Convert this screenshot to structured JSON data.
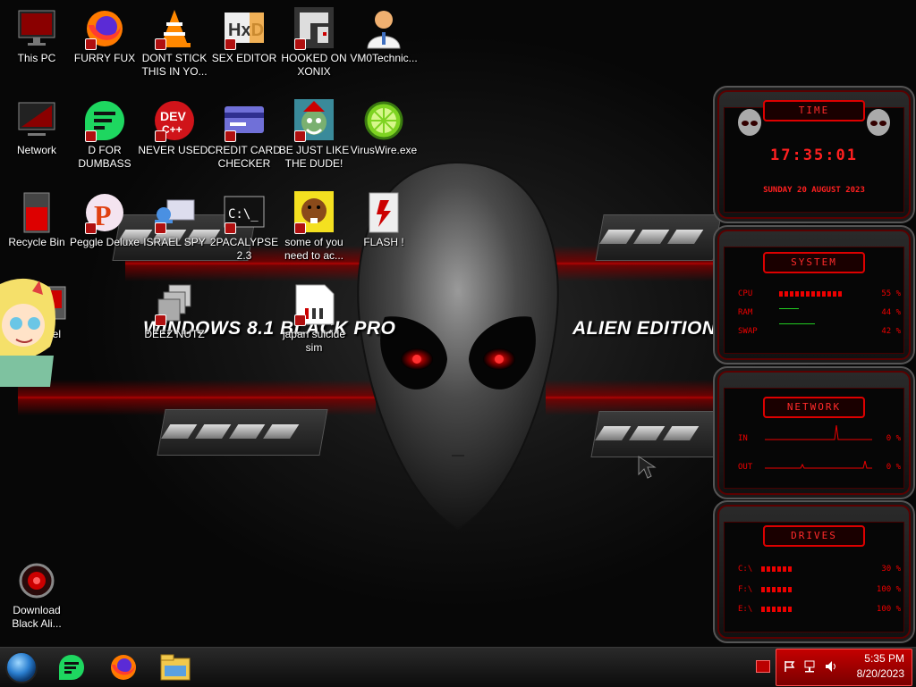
{
  "wallpaper": {
    "left_text": "WINDOWS 8.1 BLACK PRO",
    "right_text": "ALIEN EDITION 20"
  },
  "desktop_icons": [
    {
      "label": "This PC",
      "icon": "monitor-icon"
    },
    {
      "label": "FURRY FUX",
      "icon": "firefox-icon"
    },
    {
      "label": "DONT STICK THIS IN YO...",
      "icon": "vlc-cone-icon"
    },
    {
      "label": "SEX EDITOR",
      "icon": "hxd-icon"
    },
    {
      "label": "HOOKED ON XONIX",
      "icon": "xonix-game-icon"
    },
    {
      "label": "VM0Technic...",
      "icon": "doctor-avatar-icon"
    },
    {
      "label": "Network",
      "icon": "network-icon"
    },
    {
      "label": "D FOR DUMBASS",
      "icon": "green-chat-icon"
    },
    {
      "label": "NEVER USED!",
      "icon": "dev-cpp-icon"
    },
    {
      "label": "CREDIT CARD CHECKER",
      "icon": "credit-card-icon"
    },
    {
      "label": "BE JUST LIKE THE DUDE!",
      "icon": "elf-face-icon"
    },
    {
      "label": "VirusWire.exe",
      "icon": "lime-icon"
    },
    {
      "label": "Recycle Bin",
      "icon": "recycle-bin-icon"
    },
    {
      "label": "Peggle Deluxe",
      "icon": "peggle-icon"
    },
    {
      "label": "ISRAEL SPY",
      "icon": "spy-terminal-icon"
    },
    {
      "label": "2PACALYPSE 2.3",
      "icon": "console-icon"
    },
    {
      "label": "some of you need to ac...",
      "icon": "beaver-icon"
    },
    {
      "label": "FLASH !",
      "icon": "flash-icon"
    },
    {
      "label": "...nel",
      "icon": "control-panel-icon"
    },
    {
      "label": "DEEZ NUTZ",
      "icon": "stacked-windows-icon"
    },
    {
      "label": "japan suicide sim",
      "icon": "document-icon"
    },
    {
      "label": "Download Black Ali...",
      "icon": "alien-download-icon"
    }
  ],
  "widgets": {
    "time": {
      "title": "TIME",
      "clock": "17:35:01",
      "date": "SUNDAY 20 AUGUST 2023"
    },
    "system": {
      "title": "SYSTEM",
      "rows": [
        {
          "label": "CPU",
          "value": "55 %",
          "level": 0.55
        },
        {
          "label": "RAM",
          "value": "44 %",
          "level": 0.44
        },
        {
          "label": "SWAP",
          "value": "42 %",
          "level": 0.42
        }
      ]
    },
    "network": {
      "title": "NETWORK",
      "rows": [
        {
          "label": "IN",
          "value": "0 %"
        },
        {
          "label": "OUT",
          "value": "0 %"
        }
      ]
    },
    "drives": {
      "title": "DRIVES",
      "rows": [
        {
          "label": "C:\\",
          "value": "30 %",
          "level": 0.3
        },
        {
          "label": "F:\\",
          "value": "100 %",
          "level": 1.0
        },
        {
          "label": "E:\\",
          "value": "100 %",
          "level": 1.0
        }
      ]
    }
  },
  "taskbar": {
    "pinned": [
      {
        "icon": "start-orb-icon"
      },
      {
        "icon": "green-chat-icon"
      },
      {
        "icon": "firefox-icon"
      },
      {
        "icon": "file-explorer-icon"
      }
    ],
    "tray": {
      "time": "5:35 PM",
      "date": "8/20/2023"
    }
  },
  "colors": {
    "accent": "#cc0000",
    "tray": "#b00000"
  }
}
